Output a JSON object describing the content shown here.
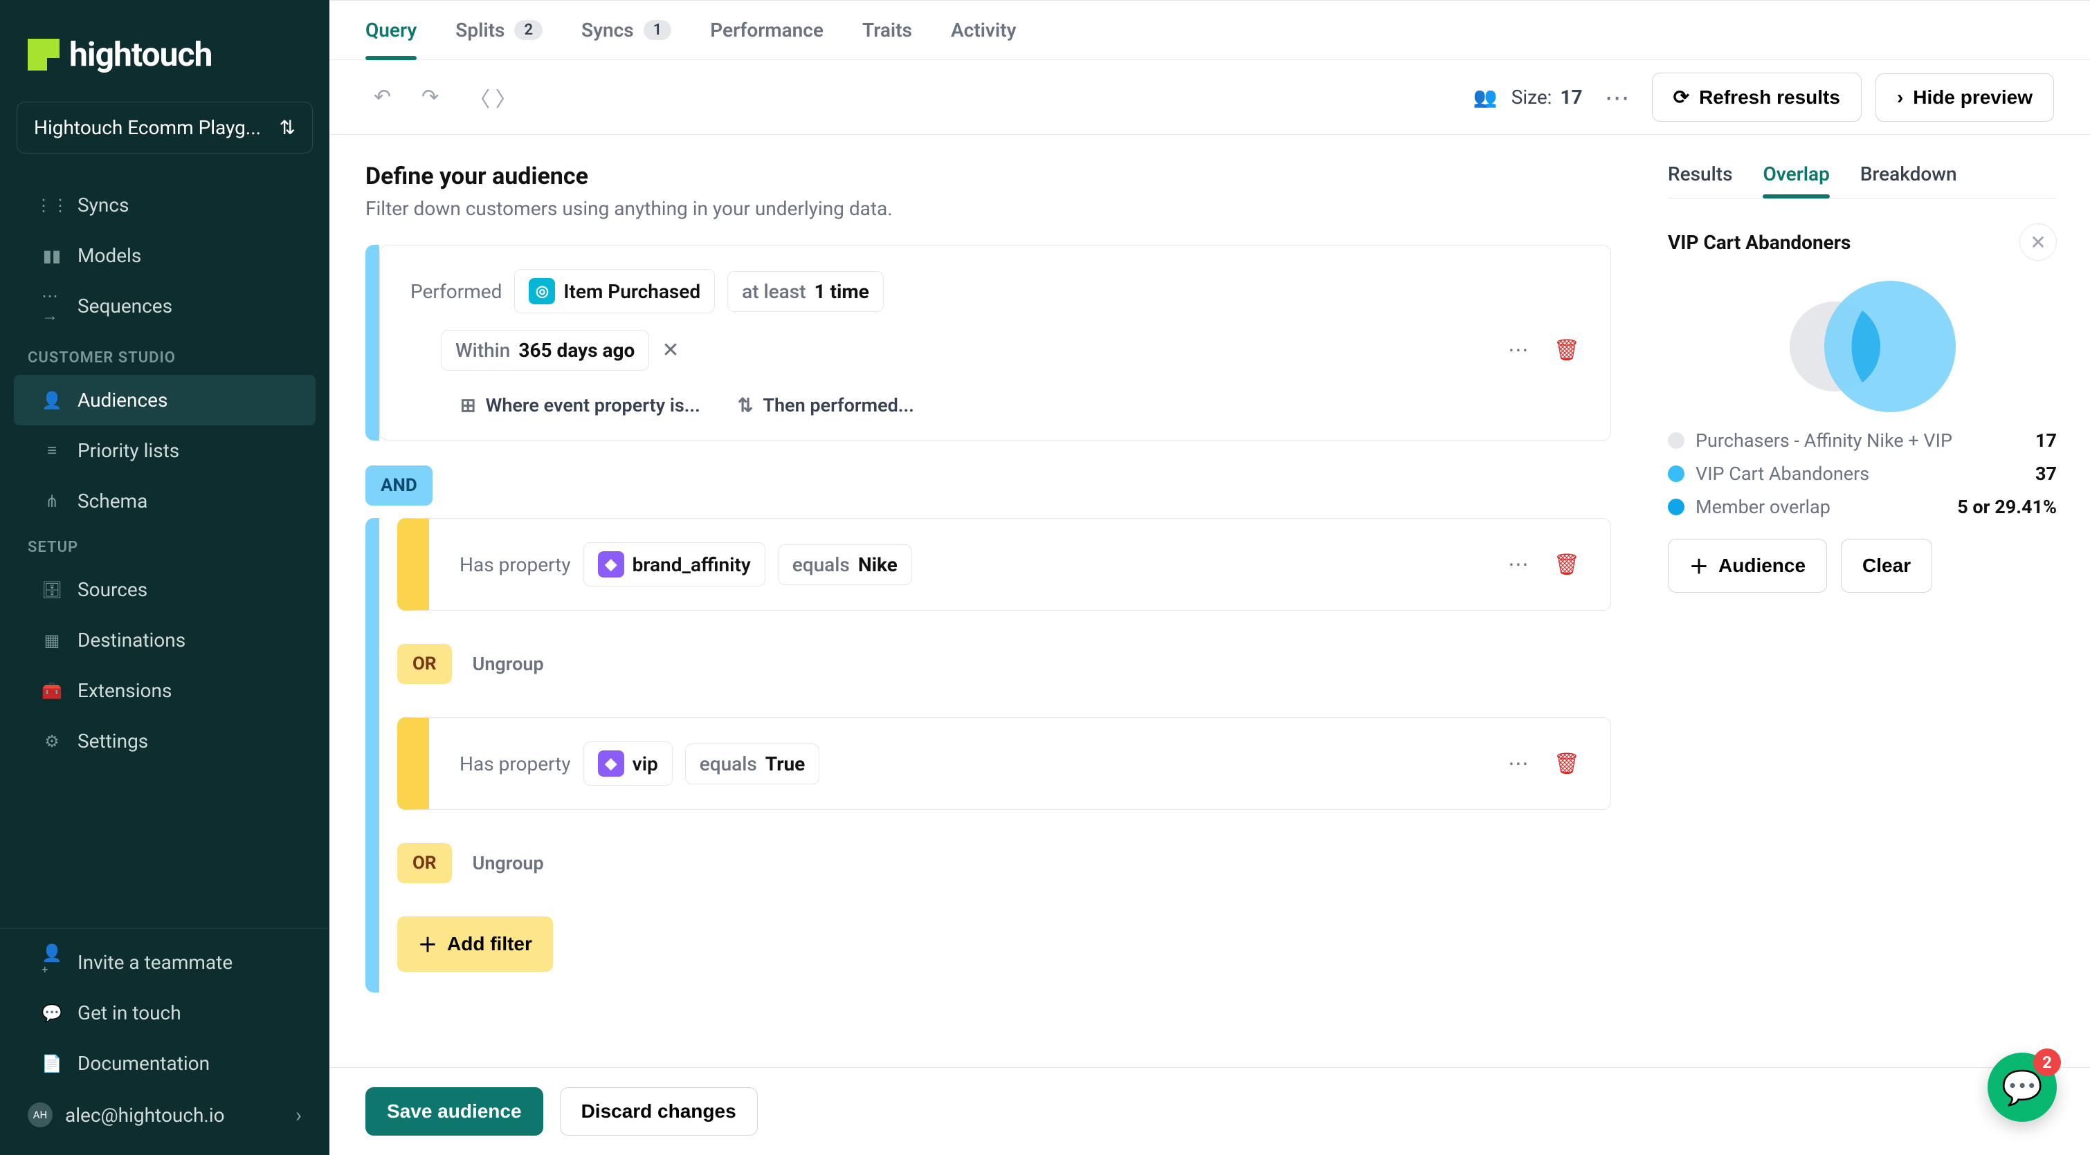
{
  "brand": "hightouch",
  "workspace": "Hightouch Ecomm Playg...",
  "sidebar": {
    "top": [
      {
        "label": "Syncs",
        "icon": "syncs"
      },
      {
        "label": "Models",
        "icon": "models"
      },
      {
        "label": "Sequences",
        "icon": "sequences"
      }
    ],
    "sections": [
      {
        "header": "CUSTOMER STUDIO",
        "items": [
          {
            "label": "Audiences",
            "icon": "audiences",
            "active": true
          },
          {
            "label": "Priority lists",
            "icon": "priority"
          },
          {
            "label": "Schema",
            "icon": "schema"
          }
        ]
      },
      {
        "header": "SETUP",
        "items": [
          {
            "label": "Sources",
            "icon": "sources"
          },
          {
            "label": "Destinations",
            "icon": "destinations"
          },
          {
            "label": "Extensions",
            "icon": "extensions"
          },
          {
            "label": "Settings",
            "icon": "settings"
          }
        ]
      }
    ],
    "bottom": [
      {
        "label": "Invite a teammate",
        "icon": "invite"
      },
      {
        "label": "Get in touch",
        "icon": "chat"
      },
      {
        "label": "Documentation",
        "icon": "docs"
      }
    ],
    "user": {
      "initials": "AH",
      "email": "alec@hightouch.io"
    }
  },
  "tabs": [
    {
      "label": "Query",
      "active": true
    },
    {
      "label": "Splits",
      "count": "2"
    },
    {
      "label": "Syncs",
      "count": "1"
    },
    {
      "label": "Performance"
    },
    {
      "label": "Traits"
    },
    {
      "label": "Activity"
    }
  ],
  "toolbar": {
    "size_label": "Size:",
    "size_value": "17",
    "refresh": "Refresh results",
    "hide_preview": "Hide preview"
  },
  "builder": {
    "title": "Define your audience",
    "subtitle": "Filter down customers using anything in your underlying data.",
    "performed": "Performed",
    "event": "Item Purchased",
    "at_least_pre": "at least ",
    "at_least_val": "1 time",
    "within_pre": "Within ",
    "within_val": "365 days ago",
    "where_event": "Where event property is...",
    "then_performed": "Then performed...",
    "and": "AND",
    "or": "OR",
    "has_property": "Has property",
    "prop1": "brand_affinity",
    "equals": "equals ",
    "val1": "Nike",
    "prop2": "vip",
    "val2": "True",
    "ungroup": "Ungroup",
    "add_filter": "Add filter"
  },
  "preview": {
    "tabs": [
      "Results",
      "Overlap",
      "Breakdown"
    ],
    "active_tab": "Overlap",
    "title": "VIP Cart Abandoners",
    "legend": [
      {
        "color": "#e5e7eb",
        "label": "Purchasers - Affinity Nike + VIP",
        "value": "17"
      },
      {
        "color": "#38bdf8",
        "label": "VIP Cart Abandoners",
        "value": "37"
      },
      {
        "color": "#0ea5e9",
        "label": "Member overlap",
        "value": "5 or 29.41%"
      }
    ],
    "audience_btn": "Audience",
    "clear_btn": "Clear"
  },
  "chart_data": {
    "type": "venn",
    "sets": [
      {
        "name": "Purchasers - Affinity Nike + VIP",
        "size": 17
      },
      {
        "name": "VIP Cart Abandoners",
        "size": 37
      }
    ],
    "overlap": {
      "size": 5,
      "percent": 29.41
    }
  },
  "footer": {
    "save": "Save audience",
    "discard": "Discard changes"
  },
  "chat_count": "2"
}
